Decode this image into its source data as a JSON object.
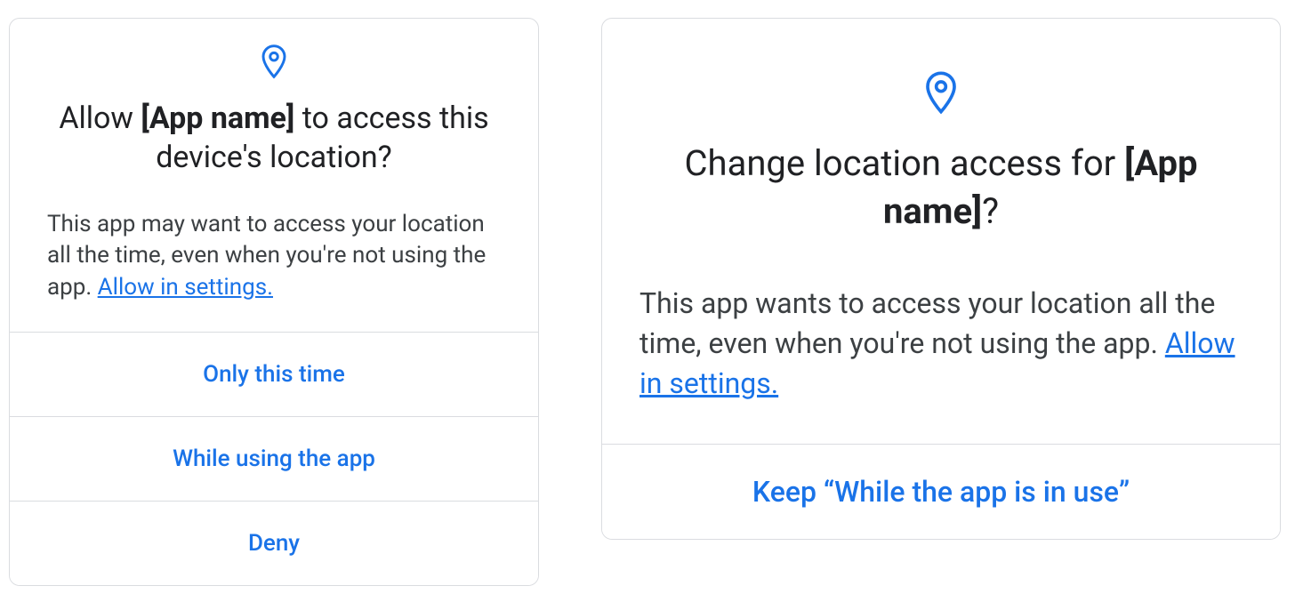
{
  "dialog_left": {
    "title_prefix": "Allow ",
    "app_name": "[App name]",
    "title_suffix": " to access this device's location?",
    "body_text": "This app may want to access your location all the time, even when you're not using the app. ",
    "settings_link": "Allow in settings.",
    "buttons": {
      "only_this_time": "Only this time",
      "while_using": "While using the app",
      "deny": "Deny"
    }
  },
  "dialog_right": {
    "title_prefix": "Change location access for ",
    "app_name": "[App name]",
    "title_suffix": "?",
    "body_text": "This app wants to access your location all the time, even when you're not using the app. ",
    "settings_link": "Allow in settings.",
    "buttons": {
      "keep": "Keep “While the app is in use”"
    }
  },
  "colors": {
    "accent": "#1a73e8",
    "text_primary": "#202124",
    "text_secondary": "#3c4043",
    "border": "#dadce0"
  }
}
